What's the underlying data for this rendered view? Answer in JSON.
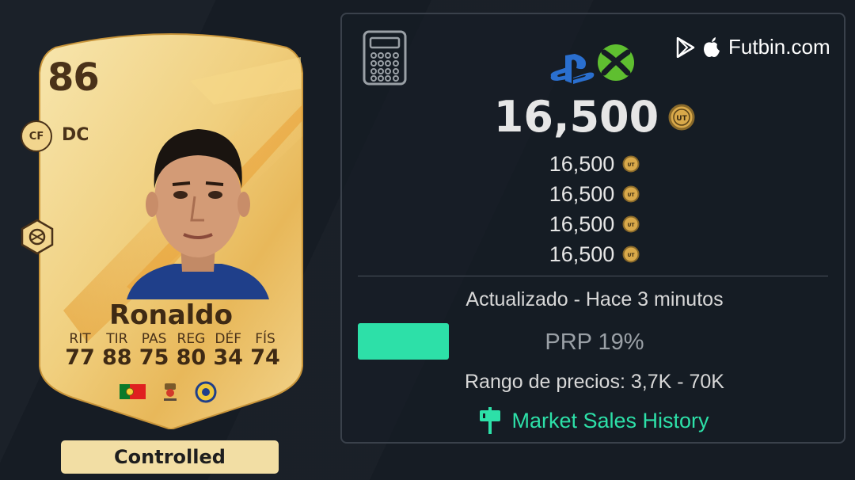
{
  "card": {
    "rating": "86",
    "alt_position": "CF",
    "position": "DC",
    "name": "Ronaldo",
    "stats": [
      {
        "label": "RIT",
        "value": "77"
      },
      {
        "label": "TIR",
        "value": "88"
      },
      {
        "label": "PAS",
        "value": "75"
      },
      {
        "label": "REG",
        "value": "80"
      },
      {
        "label": "DÉF",
        "value": "34"
      },
      {
        "label": "FÍS",
        "value": "74"
      }
    ],
    "controlled_label": "Controlled",
    "colors": {
      "gold_light": "#f7e3a6",
      "gold_dark": "#d9a94a",
      "text": "#4a3219"
    }
  },
  "panel": {
    "site_name": "Futbin.com",
    "main_price": "16,500",
    "prices": [
      "16,500",
      "16,500",
      "16,500",
      "16,500"
    ],
    "updated": "Actualizado - Hace 3 minutos",
    "prp": "PRP 19%",
    "prp_fraction": 0.19,
    "range": "Rango de precios: 3,7K - 70K",
    "history_label": "Market Sales History",
    "colors": {
      "accent": "#2de0a8",
      "background": "#161c24",
      "border": "#3a414b"
    }
  }
}
